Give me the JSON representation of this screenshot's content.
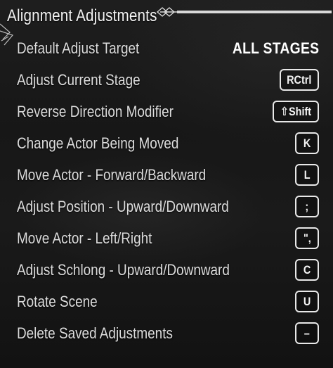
{
  "header": {
    "title": "Alignment Adjustments"
  },
  "rows": [
    {
      "label": "Default Adjust Target",
      "value": "ALL STAGES",
      "key": null
    },
    {
      "label": "Adjust Current Stage",
      "value": null,
      "key": "RCtrl"
    },
    {
      "label": "Reverse Direction Modifier",
      "value": null,
      "key": "⇧Shift"
    },
    {
      "label": "Change Actor Being Moved",
      "value": null,
      "key": "K"
    },
    {
      "label": "Move Actor - Forward/Backward",
      "value": null,
      "key": "L"
    },
    {
      "label": "Adjust Position - Upward/Downward",
      "value": null,
      "key": ";"
    },
    {
      "label": "Move Actor - Left/Right",
      "value": null,
      "key": "\","
    },
    {
      "label": "Adjust Schlong - Upward/Downward",
      "value": null,
      "key": "C"
    },
    {
      "label": "Rotate Scene",
      "value": null,
      "key": "U"
    },
    {
      "label": "Delete Saved Adjustments",
      "value": null,
      "key": "–"
    }
  ],
  "colors": {
    "text": "#dcdcdc",
    "title": "#f2f2f2",
    "keycap_border": "#e8e8e8",
    "background": "#1a1a1a"
  }
}
